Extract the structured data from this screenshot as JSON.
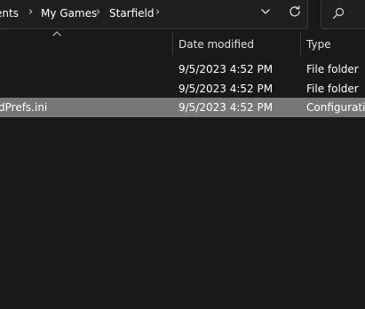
{
  "address_bar": {
    "breadcrumbs": [
      "ents",
      "My Games",
      "Starfield"
    ],
    "separator": "›"
  },
  "file_list": {
    "columns": {
      "date_modified": "Date modified",
      "type": "Type"
    },
    "rows": [
      {
        "name": "",
        "date_modified": "9/5/2023 4:52 PM",
        "type": "File folder",
        "selected": false
      },
      {
        "name": "",
        "date_modified": "9/5/2023 4:52 PM",
        "type": "File folder",
        "selected": false
      },
      {
        "name": "dPrefs.ini",
        "date_modified": "9/5/2023 4:52 PM",
        "type": "Configuration",
        "selected": true
      }
    ]
  },
  "colors": {
    "background": "#191919",
    "selected_row": "#777777",
    "text": "#ffffff"
  },
  "icons": {
    "address_dropdown": "chevron-down-icon",
    "refresh": "refresh-icon",
    "search": "search-icon",
    "sort": "sort-up-arrow-icon"
  }
}
